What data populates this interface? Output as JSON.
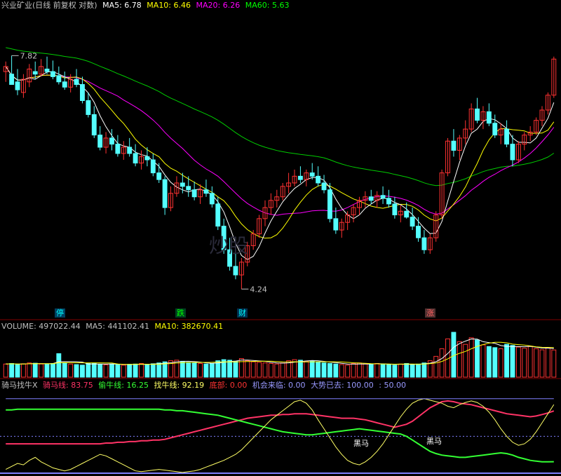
{
  "price_header": {
    "title": "兴业矿业(日线 前复权 对数)",
    "ma5": "MA5: 6.78",
    "ma10": "MA10: 6.46",
    "ma20": "MA20: 6.26",
    "ma60": "MA60: 5.63",
    "colors": {
      "title": "#c0c0c0",
      "ma5": "#ffffff",
      "ma10": "#ffff00",
      "ma20": "#ff00ff",
      "ma60": "#00ff00"
    }
  },
  "volume_header": {
    "volume": "VOLUME: 497022.44",
    "ma5": "MA5: 441102.41",
    "ma10": "MA10: 382670.41"
  },
  "indicator_header": {
    "name": "骑马找牛X",
    "qima": "骑马线: 83.75",
    "touniu": "偷牛线: 16.25",
    "zhaoniu": "找牛线: 92.19",
    "dibu": "底部: 0.00",
    "jihui": "机会来临: 0.00",
    "dashi": "大势已去: 100.00",
    "fifty": ": 50.00"
  },
  "annotations": {
    "high_label": "7.82",
    "low_label": "4.24",
    "tag_ting": "停",
    "tag_die": "跌",
    "tag_cai": "财",
    "tag_zhang": "涨",
    "heima1": "黑马",
    "heima2": "黑马",
    "watermark": "炒股"
  },
  "chart_data": [
    {
      "type": "candlestick",
      "title": "兴业矿业(日线 前复权 对数)",
      "scale": "log",
      "ylim": [
        4.0,
        8.5
      ],
      "candles": [
        [
          7.5,
          7.7,
          7.3,
          7.6
        ],
        [
          7.45,
          7.82,
          7.4,
          7.25
        ],
        [
          7.3,
          7.55,
          7.05,
          7.15
        ],
        [
          7.1,
          7.45,
          7.0,
          7.35
        ],
        [
          7.3,
          7.65,
          7.2,
          7.55
        ],
        [
          7.5,
          7.7,
          7.35,
          7.45
        ],
        [
          7.45,
          7.75,
          7.4,
          7.6
        ],
        [
          7.55,
          7.8,
          7.45,
          7.5
        ],
        [
          7.5,
          7.72,
          7.35,
          7.4
        ],
        [
          7.42,
          7.6,
          7.25,
          7.3
        ],
        [
          7.3,
          7.5,
          7.15,
          7.2
        ],
        [
          7.2,
          7.45,
          7.1,
          7.35
        ],
        [
          7.35,
          7.55,
          7.2,
          7.25
        ],
        [
          7.25,
          7.4,
          6.9,
          6.95
        ],
        [
          6.95,
          7.1,
          6.65,
          6.7
        ],
        [
          6.7,
          6.85,
          6.3,
          6.35
        ],
        [
          6.35,
          6.5,
          6.1,
          6.15
        ],
        [
          6.15,
          6.4,
          6.05,
          6.3
        ],
        [
          6.3,
          6.45,
          6.1,
          6.2
        ],
        [
          6.2,
          6.35,
          6.0,
          6.05
        ],
        [
          6.05,
          6.25,
          5.95,
          6.15
        ],
        [
          6.15,
          6.3,
          6.0,
          6.05
        ],
        [
          6.05,
          6.2,
          5.85,
          5.9
        ],
        [
          5.9,
          6.1,
          5.8,
          6.0
        ],
        [
          6.0,
          6.15,
          5.85,
          5.95
        ],
        [
          5.95,
          6.05,
          5.7,
          5.75
        ],
        [
          5.75,
          5.9,
          5.6,
          5.65
        ],
        [
          5.65,
          5.7,
          5.15,
          5.25
        ],
        [
          5.25,
          5.55,
          5.2,
          5.45
        ],
        [
          5.45,
          5.7,
          5.4,
          5.6
        ],
        [
          5.6,
          5.75,
          5.45,
          5.55
        ],
        [
          5.55,
          5.7,
          5.4,
          5.5
        ],
        [
          5.5,
          5.62,
          5.35,
          5.4
        ],
        [
          5.4,
          5.58,
          5.3,
          5.5
        ],
        [
          5.5,
          5.65,
          5.4,
          5.45
        ],
        [
          5.45,
          5.55,
          5.25,
          5.3
        ],
        [
          5.3,
          5.4,
          4.95,
          5.0
        ],
        [
          5.0,
          5.1,
          4.65,
          4.7
        ],
        [
          4.7,
          4.85,
          4.45,
          4.5
        ],
        [
          4.5,
          4.7,
          4.35,
          4.4
        ],
        [
          4.4,
          4.6,
          4.24,
          4.55
        ],
        [
          4.55,
          4.8,
          4.5,
          4.75
        ],
        [
          4.75,
          4.95,
          4.7,
          4.9
        ],
        [
          4.9,
          5.15,
          4.85,
          5.1
        ],
        [
          5.1,
          5.35,
          5.0,
          5.25
        ],
        [
          5.25,
          5.45,
          5.15,
          5.35
        ],
        [
          5.35,
          5.5,
          5.25,
          5.4
        ],
        [
          5.4,
          5.6,
          5.35,
          5.55
        ],
        [
          5.55,
          5.75,
          5.45,
          5.6
        ],
        [
          5.6,
          5.8,
          5.55,
          5.7
        ],
        [
          5.7,
          5.85,
          5.6,
          5.65
        ],
        [
          5.65,
          5.8,
          5.55,
          5.75
        ],
        [
          5.75,
          5.9,
          5.65,
          5.7
        ],
        [
          5.7,
          5.85,
          5.55,
          5.6
        ],
        [
          5.6,
          5.72,
          5.45,
          5.5
        ],
        [
          5.5,
          5.6,
          5.05,
          5.1
        ],
        [
          5.1,
          5.25,
          4.9,
          4.95
        ],
        [
          4.95,
          5.1,
          4.85,
          5.05
        ],
        [
          5.05,
          5.2,
          4.95,
          5.15
        ],
        [
          5.15,
          5.3,
          5.05,
          5.25
        ],
        [
          5.25,
          5.4,
          5.15,
          5.35
        ],
        [
          5.35,
          5.48,
          5.25,
          5.4
        ],
        [
          5.4,
          5.5,
          5.3,
          5.35
        ],
        [
          5.35,
          5.48,
          5.25,
          5.42
        ],
        [
          5.42,
          5.55,
          5.3,
          5.38
        ],
        [
          5.38,
          5.5,
          5.25,
          5.3
        ],
        [
          5.3,
          5.4,
          5.1,
          5.15
        ],
        [
          5.15,
          5.28,
          5.05,
          5.2
        ],
        [
          5.2,
          5.32,
          5.1,
          5.12
        ],
        [
          5.12,
          5.25,
          4.95,
          5.0
        ],
        [
          5.0,
          5.12,
          4.8,
          4.85
        ],
        [
          4.85,
          4.95,
          4.65,
          4.7
        ],
        [
          4.7,
          4.9,
          4.65,
          4.85
        ],
        [
          4.85,
          5.2,
          4.8,
          5.15
        ],
        [
          5.15,
          5.8,
          5.1,
          5.75
        ],
        [
          5.75,
          6.3,
          5.7,
          6.25
        ],
        [
          6.25,
          6.45,
          6.0,
          6.1
        ],
        [
          6.1,
          6.35,
          5.95,
          6.3
        ],
        [
          6.3,
          6.6,
          6.2,
          6.45
        ],
        [
          6.45,
          6.9,
          6.4,
          6.8
        ],
        [
          6.8,
          7.0,
          6.55,
          6.6
        ],
        [
          6.6,
          6.85,
          6.45,
          6.75
        ],
        [
          6.75,
          6.9,
          6.5,
          6.55
        ],
        [
          6.55,
          6.7,
          6.3,
          6.35
        ],
        [
          6.35,
          6.55,
          6.2,
          6.45
        ],
        [
          6.45,
          6.6,
          6.15,
          6.2
        ],
        [
          6.2,
          6.35,
          5.85,
          5.95
        ],
        [
          5.95,
          6.25,
          5.9,
          6.2
        ],
        [
          6.2,
          6.4,
          6.1,
          6.35
        ],
        [
          6.35,
          6.5,
          6.25,
          6.4
        ],
        [
          6.4,
          6.65,
          6.35,
          6.6
        ],
        [
          6.6,
          6.85,
          6.5,
          6.78
        ],
        [
          6.78,
          7.1,
          6.7,
          7.05
        ],
        [
          7.05,
          7.8,
          7.0,
          7.75
        ]
      ]
    },
    {
      "type": "bar",
      "title": "VOLUME",
      "values": [
        240,
        250,
        230,
        245,
        260,
        255,
        240,
        235,
        250,
        430,
        260,
        240,
        230,
        220,
        250,
        260,
        235,
        225,
        240,
        230,
        220,
        235,
        240,
        250,
        230,
        245,
        260,
        280,
        300,
        310,
        290,
        270,
        260,
        250,
        240,
        250,
        300,
        320,
        310,
        290,
        340,
        300,
        280,
        270,
        260,
        250,
        240,
        260,
        300,
        320,
        310,
        290,
        300,
        280,
        260,
        250,
        240,
        230,
        220,
        250,
        260,
        240,
        230,
        250,
        240,
        230,
        220,
        240,
        250,
        230,
        240,
        260,
        300,
        380,
        520,
        700,
        820,
        650,
        600,
        720,
        680,
        590,
        560,
        540,
        520,
        600,
        580,
        550,
        530,
        560,
        520,
        500,
        540,
        497
      ]
    },
    {
      "type": "line",
      "title": "骑马找牛X",
      "series": [
        {
          "name": "骑马线",
          "values": [
            40,
            40,
            40,
            40,
            40,
            40,
            40,
            40,
            40,
            40,
            40,
            40,
            40,
            40,
            40,
            40,
            40,
            41,
            41,
            42,
            42,
            43,
            43,
            44,
            44,
            45,
            45,
            46,
            48,
            50,
            52,
            54,
            56,
            58,
            60,
            62,
            64,
            66,
            68,
            70,
            72,
            74,
            75,
            76,
            77,
            78,
            78,
            79,
            79,
            80,
            80,
            80,
            79,
            78,
            77,
            76,
            75,
            74,
            74,
            74,
            73,
            72,
            70,
            68,
            66,
            64,
            62,
            64,
            66,
            70,
            76,
            82,
            88,
            92,
            96,
            97,
            96,
            94,
            93,
            92,
            90,
            88,
            86,
            84,
            82,
            80,
            79,
            78,
            77,
            76,
            77,
            79,
            81,
            83.75
          ]
        },
        {
          "name": "偷牛线",
          "values": [
            85,
            85,
            86,
            86,
            86,
            86,
            86,
            86,
            86,
            86,
            86,
            86,
            86,
            86,
            86,
            86,
            86,
            86,
            86,
            86,
            86,
            86,
            86,
            86,
            86,
            86,
            86,
            85,
            85,
            84,
            84,
            83,
            82,
            81,
            80,
            79,
            78,
            76,
            74,
            72,
            70,
            68,
            66,
            64,
            62,
            60,
            58,
            56,
            55,
            54,
            53,
            52,
            52,
            53,
            54,
            55,
            56,
            57,
            58,
            59,
            60,
            59,
            58,
            57,
            56,
            55,
            54,
            53,
            50,
            45,
            40,
            35,
            30,
            27,
            25,
            24,
            23,
            22,
            22,
            23,
            24,
            25,
            26,
            27,
            28,
            27,
            25,
            22,
            20,
            18,
            17,
            16,
            16,
            16.25
          ]
        },
        {
          "name": "找牛线",
          "values": [
            6,
            10,
            14,
            12,
            18,
            22,
            16,
            12,
            8,
            6,
            4,
            6,
            10,
            14,
            18,
            22,
            26,
            24,
            20,
            16,
            12,
            8,
            4,
            3,
            4,
            5,
            6,
            5,
            4,
            3,
            2,
            3,
            4,
            6,
            9,
            12,
            15,
            18,
            22,
            26,
            32,
            40,
            48,
            56,
            64,
            72,
            78,
            84,
            90,
            96,
            98,
            94,
            85,
            72,
            60,
            48,
            36,
            26,
            18,
            14,
            12,
            16,
            22,
            30,
            40,
            52,
            64,
            76,
            86,
            94,
            98,
            100,
            98,
            96,
            94,
            90,
            88,
            92,
            95,
            97,
            95,
            90,
            82,
            72,
            60,
            50,
            42,
            38,
            40,
            46,
            56,
            68,
            80,
            92.19
          ]
        },
        {
          "name": "大势已去",
          "values": [
            100,
            100,
            100,
            100,
            100,
            100,
            100,
            100,
            100,
            100,
            100,
            100,
            100,
            100,
            100,
            100,
            100,
            100,
            100,
            100,
            100,
            100,
            100,
            100,
            100,
            100,
            100,
            100,
            100,
            100,
            100,
            100,
            100,
            100,
            100,
            100,
            100,
            100,
            100,
            100,
            100,
            100,
            100,
            100,
            100,
            100,
            100,
            100,
            100,
            100,
            100,
            100,
            100,
            100,
            100,
            100,
            100,
            100,
            100,
            100,
            100,
            100,
            100,
            100,
            100,
            100,
            100,
            100,
            100,
            100,
            100,
            100,
            100,
            100,
            100,
            100,
            100,
            100,
            100,
            100,
            100,
            100,
            100,
            100,
            100,
            100,
            100,
            100,
            100,
            100,
            100,
            100,
            100,
            100
          ]
        }
      ],
      "ylim": [
        0,
        110
      ]
    }
  ]
}
